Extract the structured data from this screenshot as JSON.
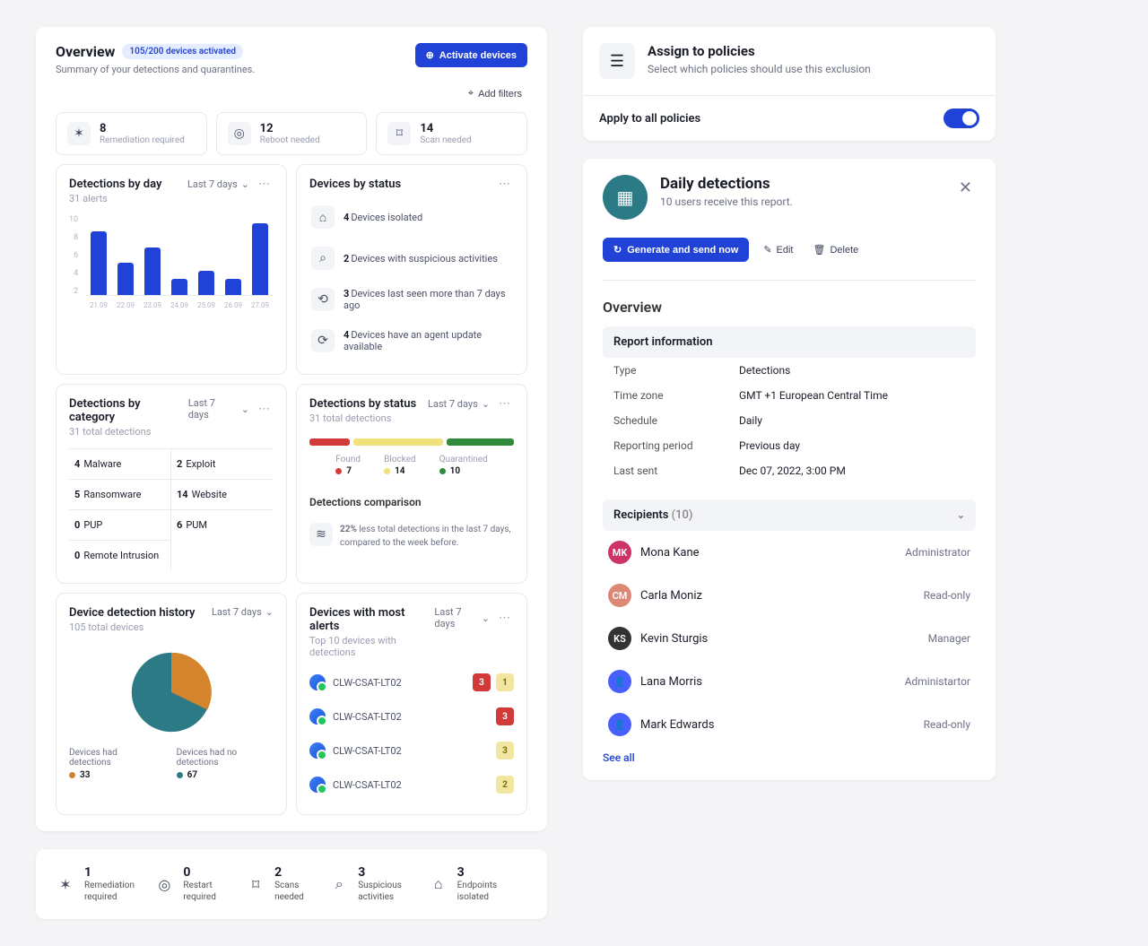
{
  "overview": {
    "title": "Overview",
    "devices_pill": "105/200 devices activated",
    "subtitle": "Summary of your detections and quarantines.",
    "activate_btn": "Activate devices",
    "add_filters": "Add filters"
  },
  "top_stats": [
    {
      "n": "8",
      "label": "Remediation required",
      "icon": "bug"
    },
    {
      "n": "12",
      "label": "Reboot needed",
      "icon": "target"
    },
    {
      "n": "14",
      "label": "Scan needed",
      "icon": "scan"
    }
  ],
  "by_day": {
    "title": "Detections by day",
    "sub": "31 alerts",
    "period": "Last 7 days"
  },
  "chart_data": {
    "type": "bar",
    "title": "Detections by day",
    "categories": [
      "21.09",
      "22.09",
      "23.09",
      "24.09",
      "25.09",
      "26.09",
      "27.09"
    ],
    "values": [
      8,
      4,
      6,
      2,
      3,
      2,
      9
    ],
    "ylabel": "alerts",
    "ylim": [
      0,
      10
    ],
    "yticks": [
      10,
      8,
      6,
      4,
      2
    ]
  },
  "by_status_devices": {
    "title": "Devices by status",
    "items": [
      {
        "n": "4",
        "txt": "Devices isolated",
        "icon": "lock"
      },
      {
        "n": "2",
        "txt": "Devices with suspicious activities",
        "icon": "binoc"
      },
      {
        "n": "3",
        "txt": "Devices last seen more than 7 days ago",
        "icon": "link"
      },
      {
        "n": "4",
        "txt": "Devices have an agent update available",
        "icon": "update"
      }
    ]
  },
  "by_category": {
    "title": "Detections by category",
    "sub": "31 total detections",
    "period": "Last 7 days",
    "cells": [
      {
        "n": "4",
        "label": "Malware"
      },
      {
        "n": "2",
        "label": "Exploit"
      },
      {
        "n": "5",
        "label": "Ransomware"
      },
      {
        "n": "14",
        "label": "Website"
      },
      {
        "n": "0",
        "label": "PUP"
      },
      {
        "n": "6",
        "label": "PUM"
      },
      {
        "n": "0",
        "label": "Remote Intrusion"
      }
    ]
  },
  "det_by_status": {
    "title": "Detections by status",
    "sub": "31 total detections",
    "period": "Last 7 days",
    "segments": [
      {
        "label": "Found",
        "n": "7",
        "color": "#d23a3a",
        "w": 18
      },
      {
        "label": "Blocked",
        "n": "14",
        "color": "#f2e07a",
        "w": 40
      },
      {
        "label": "Quarantined",
        "n": "10",
        "color": "#2f8a3a",
        "w": 30
      }
    ],
    "cmp_title": "Detections comparison",
    "cmp_pct": "22%",
    "cmp_txt": "less total detections in the last 7 days, compared to the week before."
  },
  "history": {
    "title": "Device detection history",
    "sub": "105 total devices",
    "period": "Last 7 days",
    "had_label": "Devices had detections",
    "had_n": "33",
    "none_label": "Devices had no detections",
    "none_n": "67",
    "had_color": "#d3842c",
    "none_color": "#2b7a86"
  },
  "most_alerts": {
    "title": "Devices with most alerts",
    "sub": "Top 10 devices with detections",
    "period": "Last 7 days",
    "rows": [
      {
        "name": "CLW-CSAT-LT02",
        "badges": [
          {
            "n": "3",
            "c": "red"
          },
          {
            "n": "1",
            "c": "yel"
          }
        ]
      },
      {
        "name": "CLW-CSAT-LT02",
        "badges": [
          {
            "n": "3",
            "c": "red"
          }
        ]
      },
      {
        "name": "CLW-CSAT-LT02",
        "badges": [
          {
            "n": "3",
            "c": "yel"
          }
        ]
      },
      {
        "name": "CLW-CSAT-LT02",
        "badges": [
          {
            "n": "2",
            "c": "yel"
          }
        ]
      }
    ]
  },
  "strip": [
    {
      "n": "1",
      "label": "Remediation required",
      "icon": "bug"
    },
    {
      "n": "0",
      "label": "Restart required",
      "icon": "target"
    },
    {
      "n": "2",
      "label": "Scans needed",
      "icon": "scan"
    },
    {
      "n": "3",
      "label": "Suspicious activities",
      "icon": "binoc"
    },
    {
      "n": "3",
      "label": "Endpoints isolated",
      "icon": "lock"
    }
  ],
  "policies": {
    "title": "Assign to policies",
    "sub": "Select which policies should use this exclusion",
    "apply_label": "Apply to all policies"
  },
  "daily": {
    "title": "Daily detections",
    "sub": "10 users receive this report.",
    "generate_btn": "Generate and send now",
    "edit_btn": "Edit",
    "delete_btn": "Delete",
    "overview_title": "Overview",
    "info_title": "Report information",
    "info": [
      {
        "k": "Type",
        "v": "Detections"
      },
      {
        "k": "Time zone",
        "v": "GMT +1 European Central Time"
      },
      {
        "k": "Schedule",
        "v": "Daily"
      },
      {
        "k": "Reporting period",
        "v": "Previous day"
      },
      {
        "k": "Last sent",
        "v": "Dec 07, 2022, 3:00 PM"
      }
    ],
    "recipients_label": "Recipients",
    "recipients_count": "(10)",
    "recipients": [
      {
        "name": "Mona Kane",
        "role": "Administrator",
        "color": "#c36",
        "kind": "photo"
      },
      {
        "name": "Carla Moniz",
        "role": "Read-only",
        "color": "#d87",
        "kind": "photo"
      },
      {
        "name": "Kevin Sturgis",
        "role": "Manager",
        "color": "#333",
        "kind": "photo"
      },
      {
        "name": "Lana Morris",
        "role": "Administartor",
        "color": "#4a5fff",
        "kind": "icon"
      },
      {
        "name": "Mark Edwards",
        "role": "Read-only",
        "color": "#4a5fff",
        "kind": "icon"
      }
    ],
    "see_all": "See all"
  }
}
